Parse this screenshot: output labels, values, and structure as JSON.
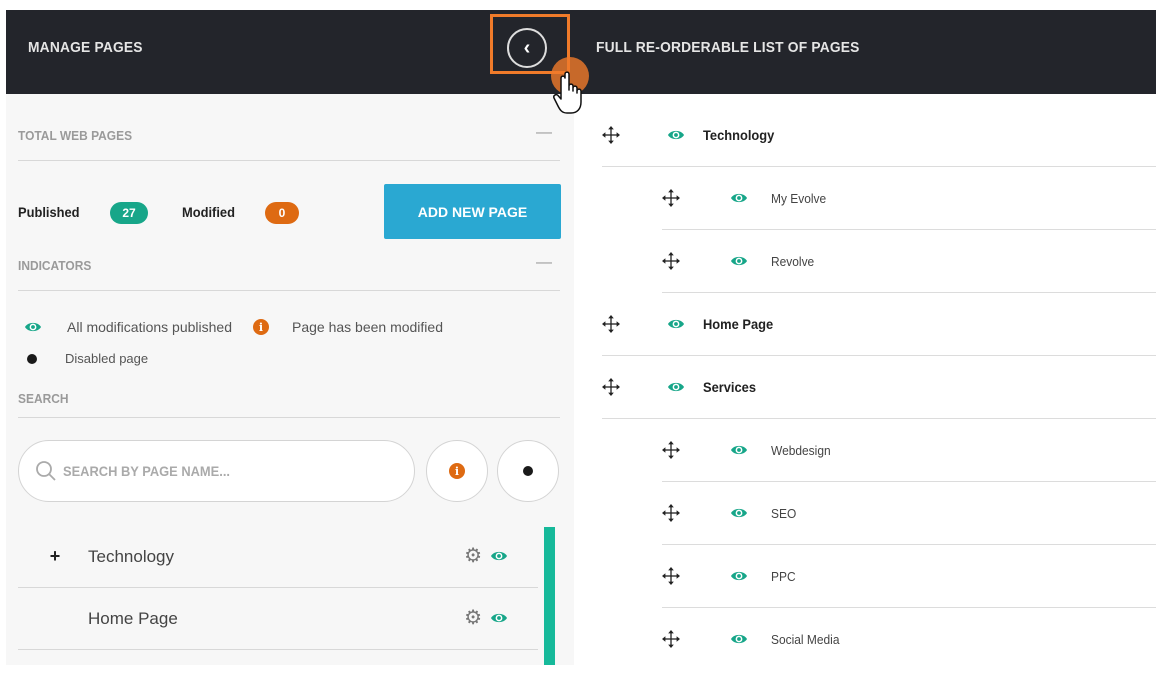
{
  "header": {
    "left_title": "MANAGE PAGES",
    "right_title": "FULL RE-ORDERABLE LIST OF PAGES",
    "collapse_icon": "chevron-left-icon",
    "highlight_color": "#f07b2a"
  },
  "sections": {
    "total": "TOTAL WEB PAGES",
    "indicators": "INDICATORS",
    "search": "SEARCH",
    "collapse_glyph": "—"
  },
  "stats": {
    "published_label": "Published",
    "published_count": "27",
    "modified_label": "Modified",
    "modified_count": "0"
  },
  "add_button": "ADD NEW PAGE",
  "indicators": {
    "published": "All modifications published",
    "modified": "Page has been modified",
    "disabled": "Disabled page"
  },
  "search": {
    "placeholder": "SEARCH BY PAGE NAME..."
  },
  "left_pages": [
    {
      "expand": "+",
      "name": "Technology"
    },
    {
      "expand": "",
      "name": "Home Page"
    }
  ],
  "tree": [
    {
      "name": "Technology",
      "level": 0
    },
    {
      "name": "My Evolve",
      "level": 1
    },
    {
      "name": "Revolve",
      "level": 1
    },
    {
      "name": "Home Page",
      "level": 0
    },
    {
      "name": "Services",
      "level": 0
    },
    {
      "name": "Webdesign",
      "level": 1
    },
    {
      "name": "SEO",
      "level": 1
    },
    {
      "name": "PPC",
      "level": 1
    },
    {
      "name": "Social Media",
      "level": 1
    }
  ],
  "colors": {
    "header_bg": "#23252b",
    "accent_green": "#17a689",
    "accent_orange": "#de6a12",
    "button_blue": "#2aa8d2"
  }
}
